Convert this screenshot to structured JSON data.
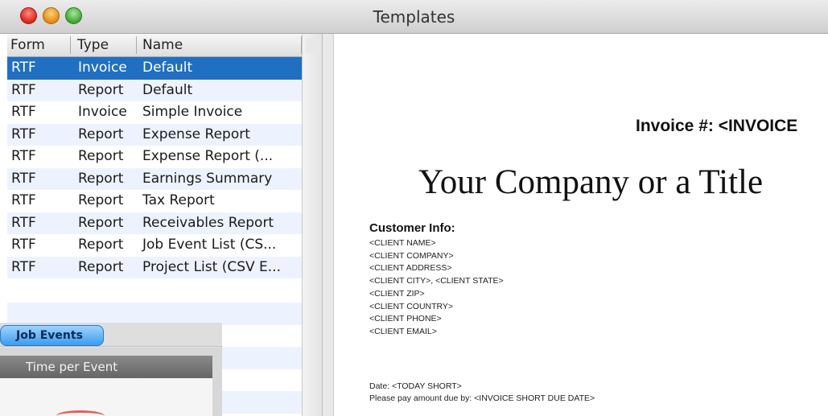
{
  "window": {
    "title": "Templates"
  },
  "table": {
    "headers": {
      "form": "Form",
      "type": "Type",
      "name": "Name"
    },
    "rows": [
      {
        "form": "RTF",
        "type": "Invoice",
        "name": "Default"
      },
      {
        "form": "RTF",
        "type": "Report",
        "name": "Default"
      },
      {
        "form": "RTF",
        "type": "Invoice",
        "name": "Simple Invoice"
      },
      {
        "form": "RTF",
        "type": "Report",
        "name": "Expense Report"
      },
      {
        "form": "RTF",
        "type": "Report",
        "name": "Expense Report (..."
      },
      {
        "form": "RTF",
        "type": "Report",
        "name": "Earnings Summary"
      },
      {
        "form": "RTF",
        "type": "Report",
        "name": "Tax Report"
      },
      {
        "form": "RTF",
        "type": "Report",
        "name": "Receivables Report"
      },
      {
        "form": "RTF",
        "type": "Report",
        "name": "Job Event List (CS..."
      },
      {
        "form": "RTF",
        "type": "Report",
        "name": "Project List (CSV E..."
      }
    ],
    "selected_index": 0
  },
  "preview": {
    "invoice_number": "Invoice #: <INVOICE",
    "company_title": "Your Company or a Title",
    "customer_info_heading": "Customer Info:",
    "customer_fields": [
      "<CLIENT NAME>",
      "<CLIENT COMPANY>",
      "<CLIENT ADDRESS>",
      "<CLIENT CITY>, <CLIENT STATE>",
      "<CLIENT ZIP>",
      "<CLIENT COUNTRY>",
      "<CLIENT PHONE>",
      "<CLIENT EMAIL>"
    ],
    "date_line": "Date: <TODAY SHORT>",
    "pay_line": "Please pay amount due by: <INVOICE SHORT DUE DATE>"
  },
  "job_window": {
    "tab_label": "Job Events",
    "panel_title": "Time per Event"
  },
  "colors": {
    "selection": "#1f6fc2",
    "row_alternate": "#edf3fe",
    "tab_active": "#3c9bef"
  }
}
